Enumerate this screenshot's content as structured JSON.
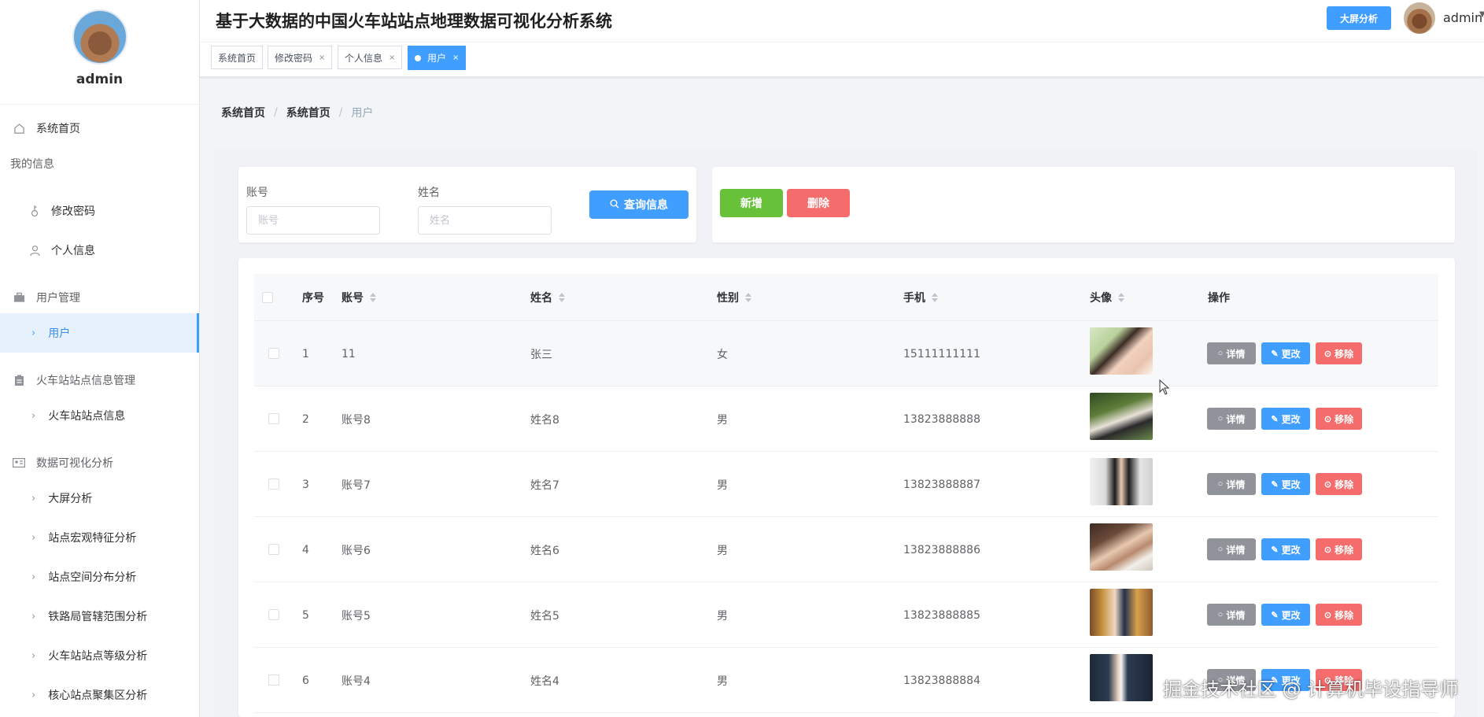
{
  "sidebar": {
    "username": "admin",
    "items": [
      {
        "label": "系统首页",
        "icon": "home-icon"
      },
      {
        "label": "我的信息",
        "icon": ""
      },
      {
        "label": "修改密码",
        "icon": "key-icon"
      },
      {
        "label": "个人信息",
        "icon": "user-icon"
      },
      {
        "label": "用户管理",
        "icon": "briefcase-icon"
      },
      {
        "label": "用户",
        "icon": "chevron-right-icon"
      },
      {
        "label": "火车站站点信息管理",
        "icon": "clipboard-icon"
      },
      {
        "label": "火车站站点信息",
        "icon": "chevron-right-icon"
      },
      {
        "label": "数据可视化分析",
        "icon": "id-card-icon"
      },
      {
        "label": "大屏分析",
        "icon": "chevron-right-icon"
      },
      {
        "label": "站点宏观特征分析",
        "icon": "chevron-right-icon"
      },
      {
        "label": "站点空间分布分析",
        "icon": "chevron-right-icon"
      },
      {
        "label": "铁路局管辖范围分析",
        "icon": "chevron-right-icon"
      },
      {
        "label": "火车站站点等级分析",
        "icon": "chevron-right-icon"
      },
      {
        "label": "核心站点聚集区分析",
        "icon": "chevron-right-icon"
      }
    ]
  },
  "header": {
    "title": "基于大数据的中国火车站站点地理数据可视化分析系统",
    "bigscreen_label": "大屏分析",
    "user_name": "admin"
  },
  "tabs": [
    {
      "label": "系统首页"
    },
    {
      "label": "修改密码",
      "close": "×"
    },
    {
      "label": "个人信息",
      "close": "×"
    },
    {
      "label": "用户",
      "close": "×",
      "active": true
    }
  ],
  "breadcrumb": [
    "系统首页",
    "系统首页",
    "用户"
  ],
  "search": {
    "account_label": "账号",
    "account_placeholder": "账号",
    "name_label": "姓名",
    "name_placeholder": "姓名",
    "query_label": "查询信息"
  },
  "actions": {
    "add_label": "新增",
    "delete_label": "删除"
  },
  "table": {
    "headers": [
      "序号",
      "账号",
      "姓名",
      "性别",
      "手机",
      "头像",
      "操作"
    ],
    "detail_label": "详情",
    "edit_label": "更改",
    "remove_label": "移除",
    "rows": [
      {
        "index": "1",
        "account": "11",
        "name": "张三",
        "gender": "女",
        "phone": "15111111111"
      },
      {
        "index": "2",
        "account": "账号8",
        "name": "姓名8",
        "gender": "男",
        "phone": "13823888888"
      },
      {
        "index": "3",
        "account": "账号7",
        "name": "姓名7",
        "gender": "男",
        "phone": "13823888887"
      },
      {
        "index": "4",
        "account": "账号6",
        "name": "姓名6",
        "gender": "男",
        "phone": "13823888886"
      },
      {
        "index": "5",
        "account": "账号5",
        "name": "姓名5",
        "gender": "男",
        "phone": "13823888885"
      },
      {
        "index": "6",
        "account": "账号4",
        "name": "姓名4",
        "gender": "男",
        "phone": "13823888884"
      }
    ]
  },
  "watermark": "掘金技术社区 @ 计算机毕设指导师",
  "colors": {
    "primary": "#409eff",
    "success": "#67c23a",
    "danger": "#f56c6c",
    "info": "#909399"
  }
}
